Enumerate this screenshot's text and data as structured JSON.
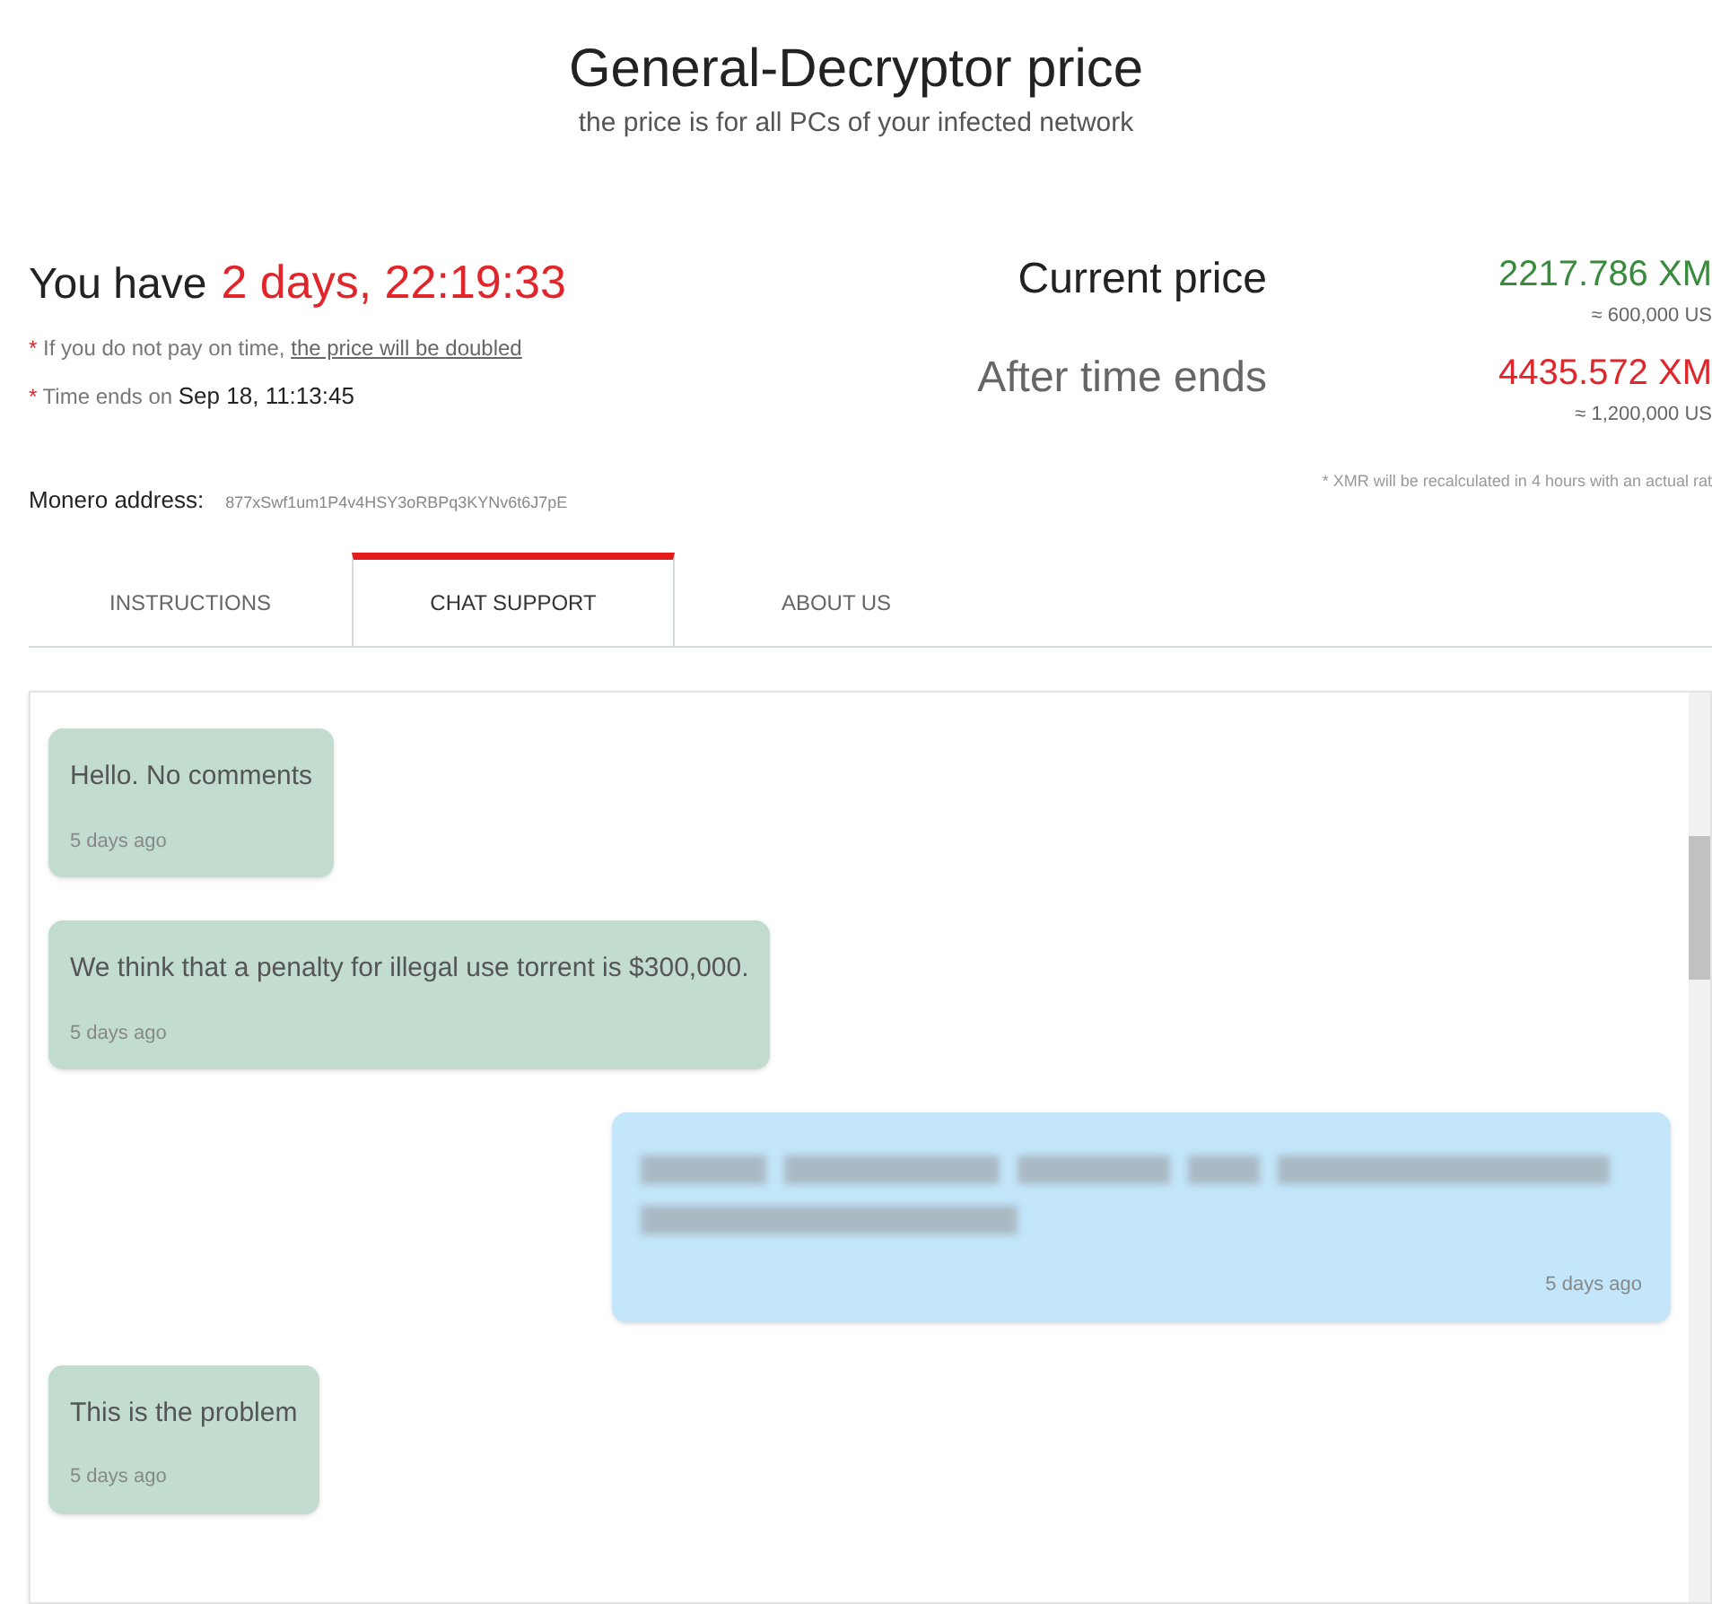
{
  "header": {
    "title": "General-Decryptor price",
    "subtitle": "the price is for all PCs of your infected network"
  },
  "timer": {
    "label": "You have",
    "value": "2 days, 22:19:33",
    "notes": [
      {
        "mark": "*",
        "text": "If you do not pay on time, ",
        "link": "the price will be doubled"
      },
      {
        "mark": "*",
        "text": "Time ends on ",
        "strong": "Sep 18, 11:13:45"
      }
    ]
  },
  "prices": [
    {
      "label": "Current price",
      "amount": "2217.786 XM",
      "usd": "≈ 600,000 US",
      "kind": "current"
    },
    {
      "label": "After time ends",
      "amount": "4435.572 XM",
      "usd": "≈ 1,200,000 US",
      "kind": "after"
    }
  ],
  "address": {
    "label": "Monero address:",
    "value": "877xSwf1um1P4v4HSY3oRBPq3KYNv6t6J7pE"
  },
  "rate_note": "* XMR will be recalculated in 4 hours with an actual rat",
  "tabs": [
    {
      "label": "INSTRUCTIONS",
      "selected": false
    },
    {
      "label": "CHAT SUPPORT",
      "selected": true
    },
    {
      "label": "ABOUT US",
      "selected": false
    }
  ],
  "messages": [
    {
      "kind": "support",
      "text": "Hello. No comments",
      "time": "5 days ago"
    },
    {
      "kind": "support",
      "text": "We think that a penalty for illegal use torrent is $300,000.",
      "time": "5 days ago"
    },
    {
      "kind": "redacted",
      "time": "5 days ago"
    },
    {
      "kind": "support",
      "text": "This is the problem",
      "time": "5 days ago"
    }
  ]
}
